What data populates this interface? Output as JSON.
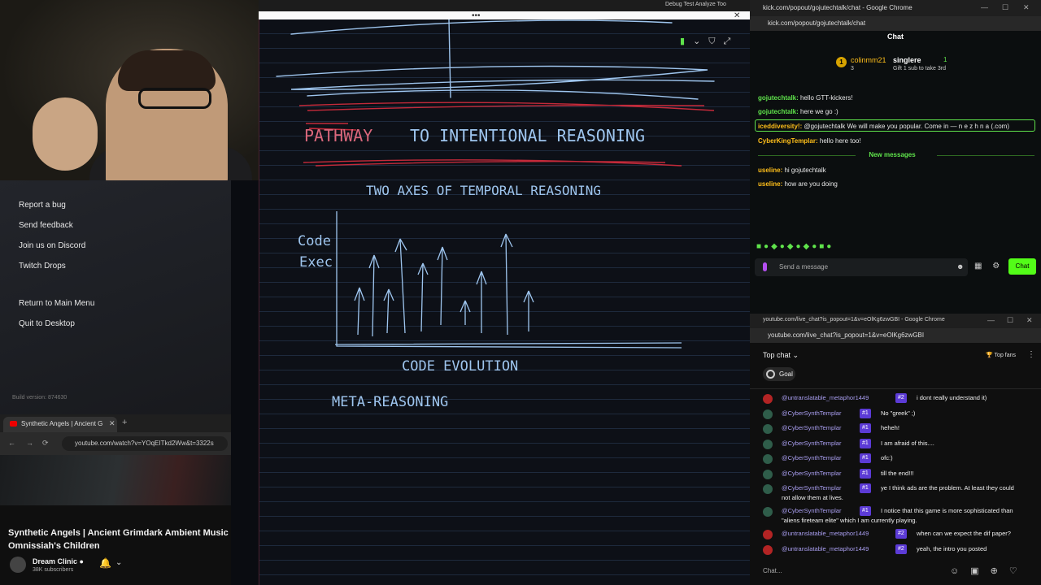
{
  "game_menu": {
    "items": [
      "Report a bug",
      "Send feedback",
      "Join us on Discord",
      "Twitch Drops",
      "Return to Main Menu",
      "Quit to Desktop"
    ],
    "build_version": "Build version: 874630"
  },
  "youtube_window": {
    "tab_title": "Synthetic Angels | Ancient G",
    "url": "youtube.com/watch?v=YOqEITkd2Ww&t=3322s",
    "video_title": "Synthetic Angels | Ancient Grimdark Ambient Music Omnissiah's Children",
    "channel": "Dream Clinic",
    "subscribers": "38K subscribers"
  },
  "canvas": {
    "top_menu": "Debug    Test    Analyze    Too",
    "tool_icons": [
      "highlighter-icon",
      "dropdown-icon",
      "filter-icon",
      "expand-icon"
    ]
  },
  "kick_chat": {
    "window_title": "kick.com/popout/gojutechtalk/chat - Google Chrome",
    "url": "kick.com/popout/gojutechtalk/chat",
    "header": "Chat",
    "leader": {
      "rank": "1",
      "user1": "colinmm21",
      "count1": "3",
      "user2": "singlere",
      "count2": "1",
      "gift_text": "Gift 1 sub to take 3rd"
    },
    "messages": [
      {
        "user": "gojutechtalk:",
        "text": "hello GTT-kickers!",
        "color": "#5fe34b"
      },
      {
        "user": "gojutechtalk:",
        "text": "here we go :)",
        "color": "#5fe34b"
      },
      {
        "user": "iceddiversity!:",
        "text": "@gojutechtalk We will make you popular. Come in — n e z h n a (.com)",
        "color": "#ffbf1a"
      },
      {
        "user": "CyberKingTemplar:",
        "text": "hello here too!",
        "color": "#ffbf1a"
      }
    ],
    "new_messages_label": "New messages",
    "new_messages": [
      {
        "user": "useline:",
        "text": "hi gojutechtalk",
        "color": "#ffbf1a"
      },
      {
        "user": "useline:",
        "text": "how are you doing",
        "color": "#ffbf1a"
      }
    ],
    "input_placeholder": "Send a message",
    "send_label": "Chat"
  },
  "youtube_chat": {
    "window_title": "youtube.com/live_chat?is_popout=1&v=eOlKg6zwGBI - Google Chrome",
    "url": "youtube.com/live_chat?is_popout=1&v=eOlKg6zwGBI",
    "mode": "Top chat",
    "top_fans": "Top fans",
    "goal": "Goal",
    "messages": [
      {
        "author": "@untranslatable_metaphor1449",
        "badge": "#2",
        "text": "i dont really understand it)",
        "av": "#b32424"
      },
      {
        "author": "@CyberSynthTemplar",
        "badge": "#1",
        "text": "No \"greek\" ;)",
        "av": "#2f5d4a"
      },
      {
        "author": "@CyberSynthTemplar",
        "badge": "#1",
        "text": "heheh!",
        "av": "#2f5d4a"
      },
      {
        "author": "@CyberSynthTemplar",
        "badge": "#1",
        "text": "I am afraid of this....",
        "av": "#2f5d4a"
      },
      {
        "author": "@CyberSynthTemplar",
        "badge": "#1",
        "text": "ofc:)",
        "av": "#2f5d4a"
      },
      {
        "author": "@CyberSynthTemplar",
        "badge": "#1",
        "text": "till the end!!!",
        "av": "#2f5d4a"
      },
      {
        "author": "@CyberSynthTemplar",
        "badge": "#1",
        "text": "ye I think ads are the problem. At least they could",
        "text2": "not allow them at lives.",
        "av": "#2f5d4a"
      },
      {
        "author": "@CyberSynthTemplar",
        "badge": "#1",
        "text": "I notice that this game is more sophisticated than",
        "text2": "\"aliens fireteam elite\" which I am currently playing.",
        "av": "#2f5d4a"
      },
      {
        "author": "@untranslatable_metaphor1449",
        "badge": "#2",
        "text": "when can we expect the dif paper?",
        "av": "#b32424"
      },
      {
        "author": "@untranslatable_metaphor1449",
        "badge": "#2",
        "text": "yeah, the intro you posted",
        "av": "#b32424"
      }
    ],
    "input_placeholder": "Chat..."
  }
}
